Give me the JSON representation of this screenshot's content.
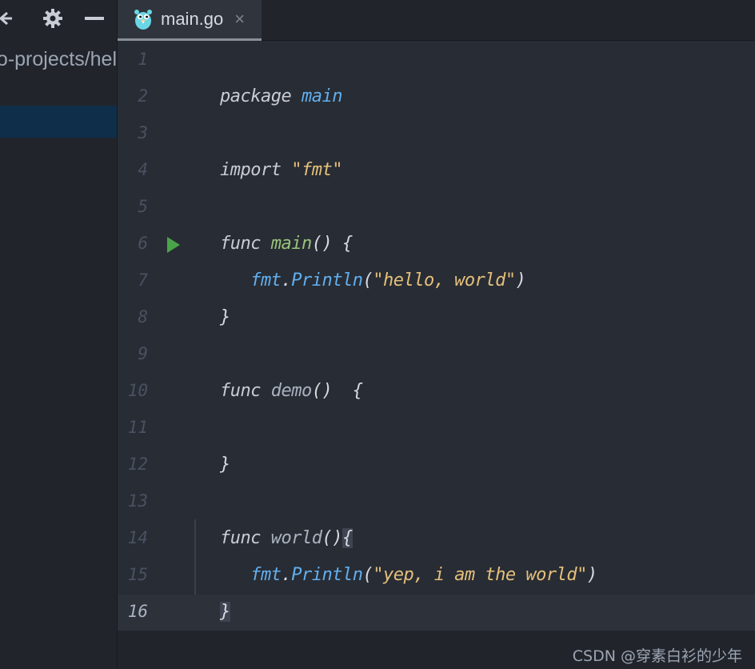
{
  "sidebar": {
    "path_text": "o-projects/hel",
    "icons": [
      "collapse-icon",
      "gear-icon",
      "minimize-icon"
    ]
  },
  "tab": {
    "title": "main.go",
    "close_label": "×",
    "icon": "gopher-icon"
  },
  "editor": {
    "line_numbers": [
      "1",
      "2",
      "3",
      "4",
      "5",
      "6",
      "7",
      "8",
      "9",
      "10",
      "11",
      "12",
      "13",
      "14",
      "15",
      "16"
    ],
    "code": {
      "l2_kw": "package",
      "l2_name": "main",
      "l4_kw": "import",
      "l4_str": "\"fmt\"",
      "l6_kw": "func",
      "l6_fn": "main",
      "l6_rest": "() {",
      "l7_pkg": "fmt",
      "l7_dot": ".",
      "l7_fn": "Println",
      "l7_open": "(",
      "l7_str": "\"hello, world\"",
      "l7_close": ")",
      "l8": "}",
      "l10_kw": "func",
      "l10_fn": "demo",
      "l10_rest": "()  {",
      "l12": "}",
      "l14_kw": "func",
      "l14_fn": "world",
      "l14_paren": "()",
      "l14_brace": "{",
      "l15_pkg": "fmt",
      "l15_dot": ".",
      "l15_fn": "Println",
      "l15_open": "(",
      "l15_str": "\"yep, i am the world\"",
      "l15_close": ")",
      "l16": "}"
    },
    "current_line": "16"
  },
  "watermark": "CSDN @穿素白衫的少年",
  "colors": {
    "background": "#282c34",
    "string": "#e5c07b",
    "package": "#61afef",
    "function": "#98c379",
    "run_marker": "#4aa54a"
  }
}
